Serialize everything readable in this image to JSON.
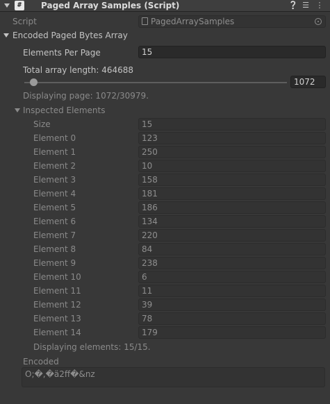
{
  "header": {
    "title": "Paged Array Samples (Script)",
    "icon_script": "#"
  },
  "script_field": {
    "label": "Script",
    "value": "PagedArraySamples"
  },
  "array": {
    "label": "Encoded Paged Bytes Array",
    "elements_per_page_label": "Elements Per Page",
    "elements_per_page_value": "15",
    "total_length_label": "Total array length: 464688",
    "page_value": "1072",
    "page_fraction": 0.0346,
    "displaying_page": "Displaying page: 1072/30979.",
    "inspected_label": "Inspected Elements",
    "size_label": "Size",
    "size_value": "15",
    "elements": [
      {
        "label": "Element 0",
        "value": "123"
      },
      {
        "label": "Element 1",
        "value": "250"
      },
      {
        "label": "Element 2",
        "value": "10"
      },
      {
        "label": "Element 3",
        "value": "158"
      },
      {
        "label": "Element 4",
        "value": "181"
      },
      {
        "label": "Element 5",
        "value": "186"
      },
      {
        "label": "Element 6",
        "value": "134"
      },
      {
        "label": "Element 7",
        "value": "220"
      },
      {
        "label": "Element 8",
        "value": "84"
      },
      {
        "label": "Element 9",
        "value": "238"
      },
      {
        "label": "Element 10",
        "value": "6"
      },
      {
        "label": "Element 11",
        "value": "11"
      },
      {
        "label": "Element 12",
        "value": "39"
      },
      {
        "label": "Element 13",
        "value": "78"
      },
      {
        "label": "Element 14",
        "value": "179"
      }
    ],
    "displaying_elements": "Displaying elements: 15/15.",
    "encoded_label": "Encoded",
    "encoded_value": "O;�,�ä2ff�&nz"
  },
  "icons": [
    "fold-arrow-icon",
    "script-icon",
    "help-icon",
    "preset-icon",
    "more-icon",
    "object-icon",
    "target-icon"
  ]
}
